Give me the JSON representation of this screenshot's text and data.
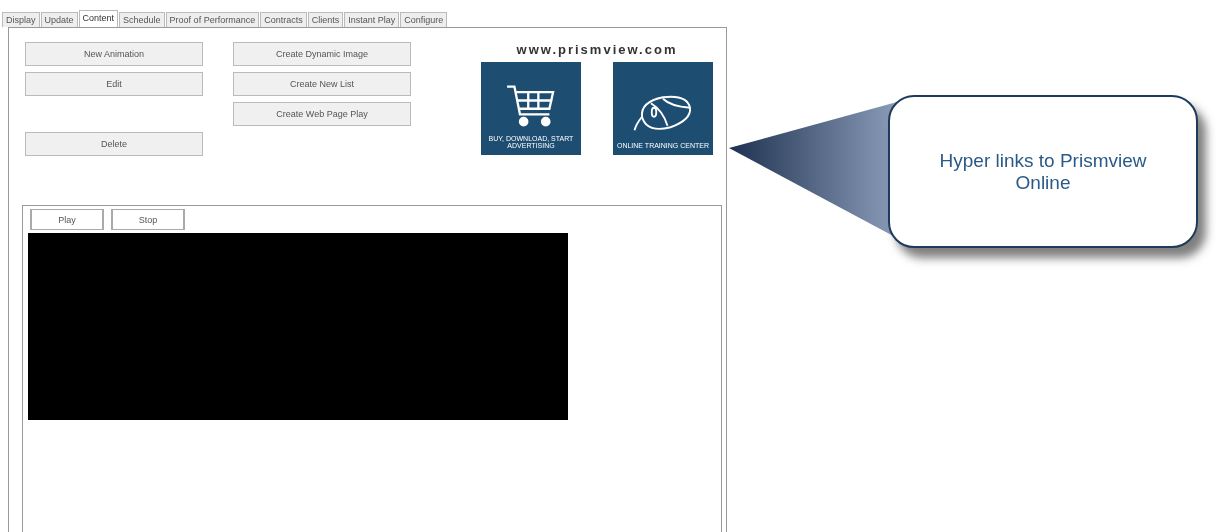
{
  "tabs": [
    {
      "label": "Display",
      "selected": false
    },
    {
      "label": "Update",
      "selected": false
    },
    {
      "label": "Content",
      "selected": true
    },
    {
      "label": "Schedule",
      "selected": false
    },
    {
      "label": "Proof of Performance",
      "selected": false
    },
    {
      "label": "Contracts",
      "selected": false
    },
    {
      "label": "Clients",
      "selected": false
    },
    {
      "label": "Instant Play",
      "selected": false
    },
    {
      "label": "Configure",
      "selected": false
    }
  ],
  "left_buttons": [
    "New Animation",
    "Edit",
    "Delete"
  ],
  "middle_buttons": [
    "Create Dynamic Image",
    "Create New List",
    "Create Web Page Play"
  ],
  "website": "www.prismview.com",
  "link_tiles": [
    {
      "kind": "cart",
      "caption": "BUY, DOWNLOAD, START ADVERTISING"
    },
    {
      "kind": "mouse",
      "caption": "ONLINE TRAINING CENTER"
    }
  ],
  "preview_buttons": [
    "Play",
    "Stop"
  ],
  "callout": "Hyper links to Prismview Online"
}
